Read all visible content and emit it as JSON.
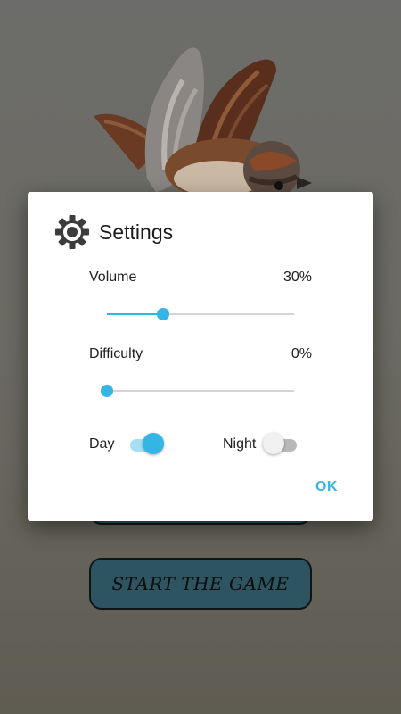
{
  "background": {
    "start_button_label": "START THE GAME",
    "accent_color": "#2c5561"
  },
  "dialog": {
    "title": "Settings",
    "title_icon": "gear-icon",
    "volume": {
      "label": "Volume",
      "value_text": "30%",
      "value": 30
    },
    "difficulty": {
      "label": "Difficulty",
      "value_text": "0%",
      "value": 0
    },
    "theme": {
      "day_label": "Day",
      "day_on": true,
      "night_label": "Night",
      "night_on": false
    },
    "ok_label": "OK",
    "accent_color": "#33b5e5"
  }
}
